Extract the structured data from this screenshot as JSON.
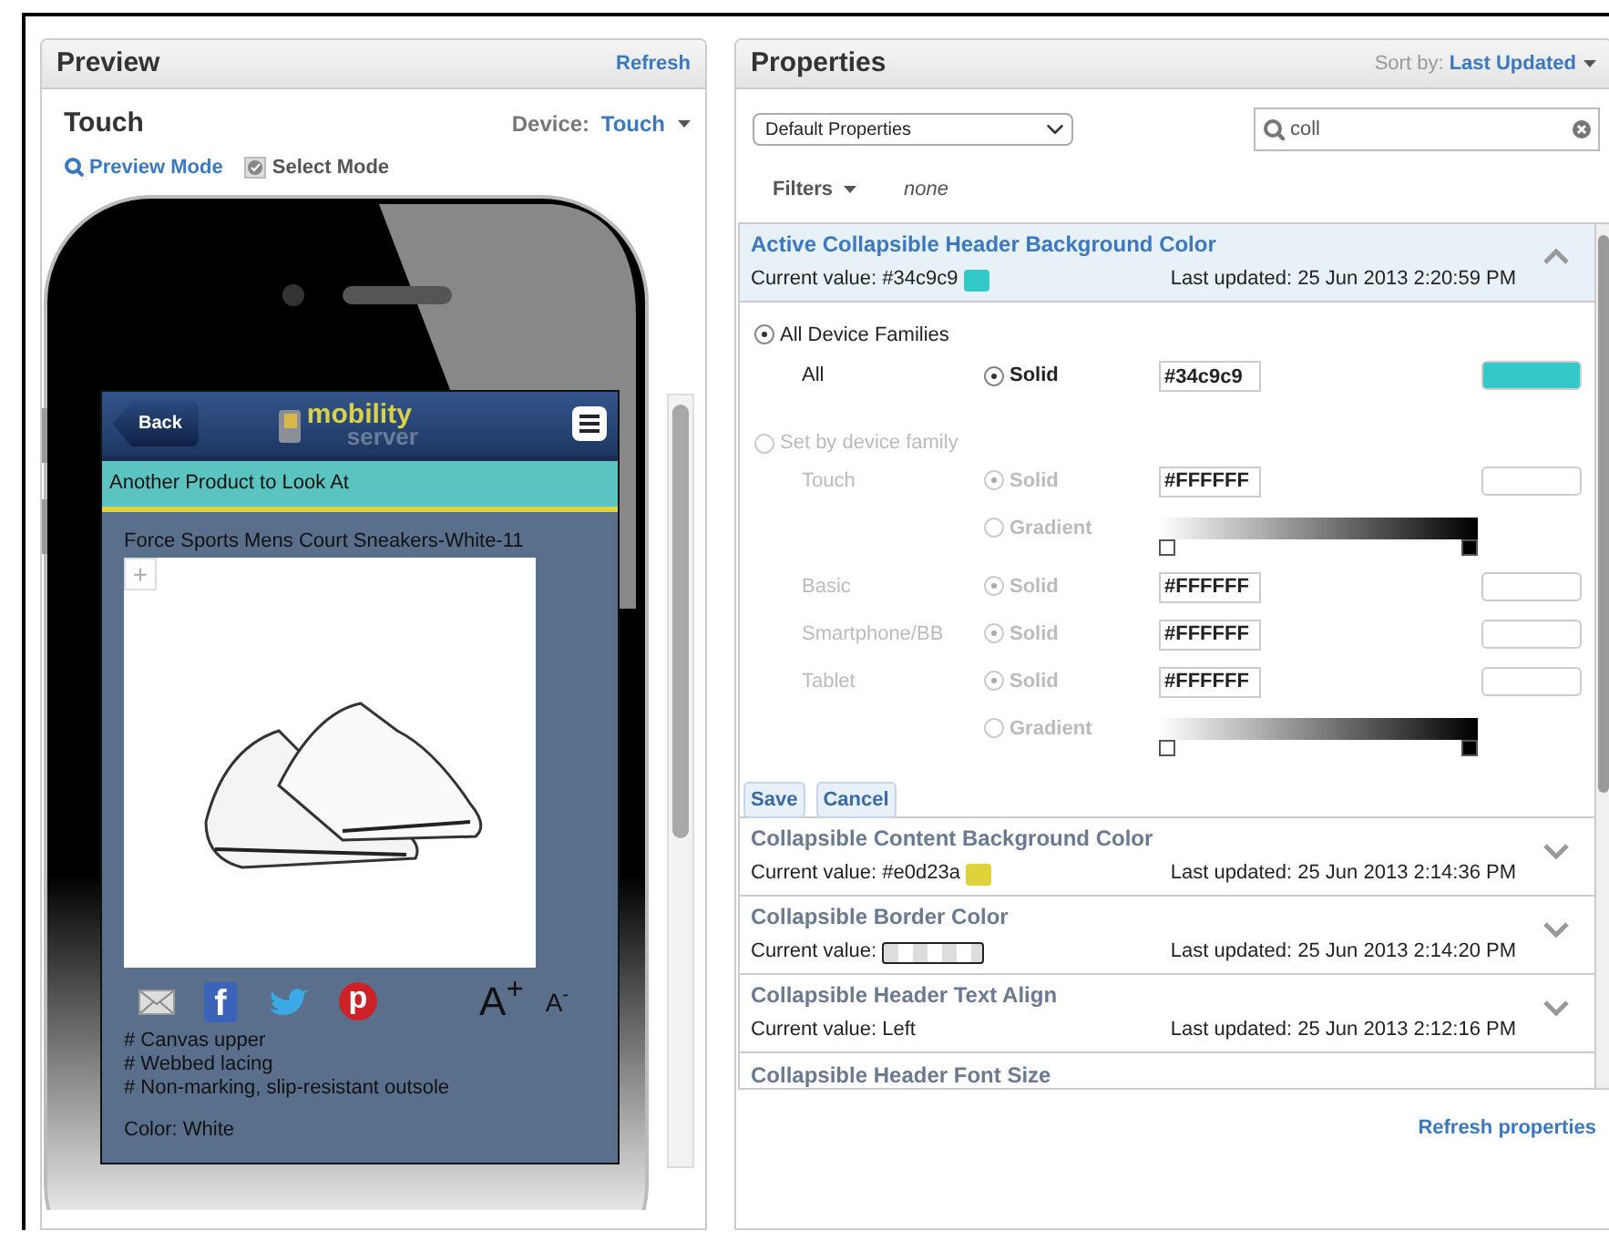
{
  "preview": {
    "title": "Preview",
    "refresh": "Refresh",
    "device_title": "Touch",
    "device_label": "Device:",
    "device_value": "Touch",
    "modes": [
      {
        "label": "Preview Mode",
        "selected": true
      },
      {
        "label": "Select Mode",
        "selected": false
      }
    ],
    "phone": {
      "back": "Back",
      "logo_main": "mobility",
      "logo_sub": "server",
      "banner": "Another Product to Look At",
      "product_title": "Force Sports Mens Court Sneakers-White-11",
      "zoom": "+",
      "share": [
        {
          "kind": "mail"
        },
        {
          "kind": "facebook",
          "glyph": "f"
        },
        {
          "kind": "twitter"
        },
        {
          "kind": "pinterest",
          "glyph": "p"
        }
      ],
      "font_buttons": [
        "A$^{+}$",
        "A$^{-}$"
      ],
      "features": [
        "# Canvas upper",
        "# Webbed lacing",
        "# Non-marking, slip-resistant outsole"
      ],
      "color_line": "Color: White"
    }
  },
  "properties": {
    "title": "Properties",
    "sort_label": "Sort by:",
    "sort_value": "Last Updated",
    "set_select": "Default Properties",
    "search": {
      "value": "coll"
    },
    "filters": "Filters",
    "filter_value": "none",
    "items": [
      {
        "name": "Active Collapsible Header Background Color",
        "current": "Current value: #34c9c9",
        "swatch": {
          "kind": "color",
          "color": "#34c9c9"
        },
        "updated": "Last updated: 25 Jun 2013 2:20:59 PM",
        "expanded": true,
        "editor": {
          "modes": [
            {
              "label": "All Device Families",
              "selected": true
            },
            {
              "label": "Set by device family",
              "selected": false
            }
          ],
          "all": {
            "label": "All",
            "fills": [
              {
                "label": "Solid",
                "selected": true
              }
            ],
            "value": "#34c9c9",
            "color": "#34c9c9"
          },
          "families_disabled": true,
          "families": [
            {
              "label": "Touch",
              "kind": "gradient",
              "fills": [
                {
                  "label": "Solid",
                  "selected": true
                },
                {
                  "label": "Gradient",
                  "selected": false
                }
              ],
              "value": "#FFFFFF",
              "color": "#ffffff"
            },
            {
              "label": "Basic",
              "kind": "solid",
              "fills": [
                {
                  "label": "Solid",
                  "selected": true
                }
              ],
              "value": "#FFFFFF",
              "color": "#ffffff"
            },
            {
              "label": "Smartphone/BB",
              "kind": "solid",
              "fills": [
                {
                  "label": "Solid",
                  "selected": true
                }
              ],
              "value": "#FFFFFF",
              "color": "#ffffff"
            },
            {
              "label": "Tablet",
              "kind": "gradient",
              "fills": [
                {
                  "label": "Solid",
                  "selected": true
                },
                {
                  "label": "Gradient",
                  "selected": false
                }
              ],
              "value": "#FFFFFF",
              "color": "#ffffff"
            }
          ],
          "buttons": [
            "Save",
            "Cancel"
          ]
        }
      },
      {
        "name": "Collapsible Content Background Color",
        "current": "Current value: #e0d23a",
        "swatch": {
          "kind": "color",
          "color": "#e0d23a"
        },
        "updated": "Last updated: 25 Jun 2013 2:14:36 PM",
        "expanded": false
      },
      {
        "name": "Collapsible Border Color",
        "current": "Current value:",
        "swatch": {
          "kind": "transparent"
        },
        "updated": "Last updated: 25 Jun 2013 2:14:20 PM",
        "expanded": false
      },
      {
        "name": "Collapsible Header Text Align",
        "current": "Current value: Left",
        "updated": "Last updated: 25 Jun 2013 2:12:16 PM",
        "expanded": false
      },
      {
        "name": "Collapsible Header Font Size",
        "expanded": false
      }
    ],
    "refresh": "Refresh properties"
  }
}
